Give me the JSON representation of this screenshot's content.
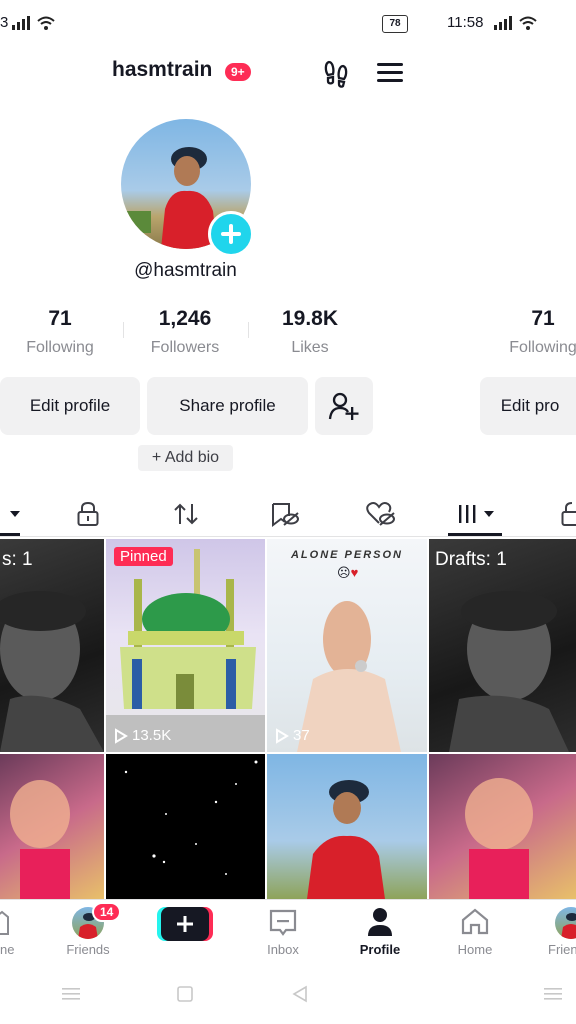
{
  "status": {
    "left_fragment": "3",
    "battery": "78",
    "time": "11:58"
  },
  "header": {
    "username": "hasmtrain",
    "badge": "9+",
    "icons": [
      "footprints-icon",
      "menu-icon"
    ]
  },
  "profile": {
    "handle": "@hasmtrain",
    "stats": [
      {
        "num": "71",
        "label": "Following"
      },
      {
        "num": "1,246",
        "label": "Followers"
      },
      {
        "num": "19.8K",
        "label": "Likes"
      }
    ],
    "right_stat": {
      "num": "71",
      "label": "Following"
    },
    "edit_label": "Edit profile",
    "share_label": "Share profile",
    "add_bio_label": "+ Add bio",
    "right_edit_label": "Edit pro"
  },
  "grid": {
    "left_draft_label": "s: 1",
    "pinned_label": "Pinned",
    "views1": "13.5K",
    "overlay_title": "ALONE PERSON",
    "views2": "37",
    "right_draft_label": "Drafts: 1"
  },
  "nav": {
    "left_fragment": "ne",
    "friends_label": "Friends",
    "friends_badge": "14",
    "inbox_label": "Inbox",
    "profile_label": "Profile",
    "home_label": "Home",
    "right_fragment": "Frien"
  },
  "colors": {
    "accent": "#fe2c55",
    "cyan": "#25f4ee",
    "plus_badge": "#20d5ec"
  }
}
